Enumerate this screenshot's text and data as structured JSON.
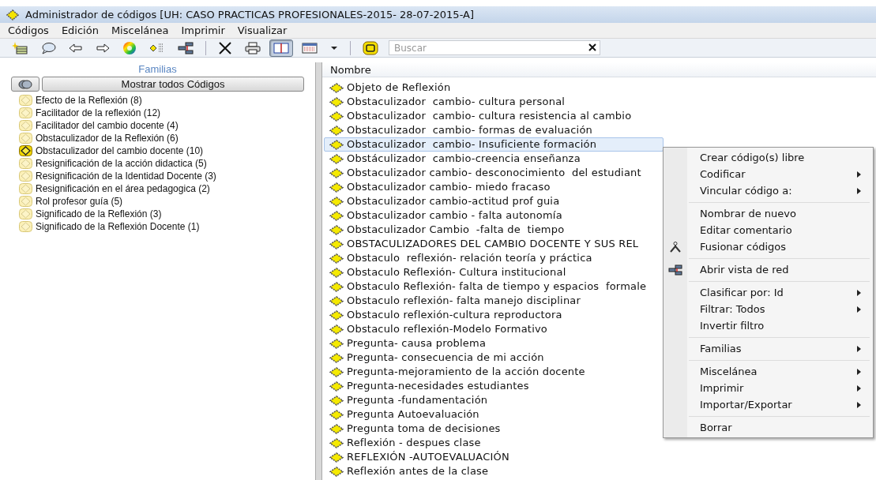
{
  "window": {
    "title": "Administrador de códigos [UH: CASO PRACTICAS PROFESIONALES-2015- 28-07-2015-A]"
  },
  "menu_bar": [
    "Códigos",
    "Edición",
    "Miscelánea",
    "Imprimir",
    "Visualizar"
  ],
  "toolbar": {
    "groups": [
      [
        {
          "kind": "new",
          "pressed": false
        },
        {
          "kind": "comment",
          "pressed": false
        },
        {
          "kind": "back",
          "pressed": false
        },
        {
          "kind": "forward",
          "pressed": false
        },
        {
          "kind": "color",
          "pressed": false
        },
        {
          "kind": "list",
          "pressed": false
        },
        {
          "kind": "network",
          "pressed": false
        }
      ],
      [
        {
          "kind": "delete",
          "pressed": false
        },
        {
          "kind": "print",
          "pressed": false
        },
        {
          "kind": "split",
          "pressed": true
        },
        {
          "kind": "grid",
          "pressed": false
        },
        {
          "kind": "dropdown",
          "pressed": false
        }
      ],
      [
        {
          "kind": "code",
          "pressed": false
        }
      ]
    ],
    "search": {
      "placeholder": "Buscar"
    }
  },
  "families": {
    "title": "Familias",
    "show_all_button": "Mostrar todos Códigos",
    "items": [
      {
        "label": "Efecto de la Reflexión (8)",
        "active": false
      },
      {
        "label": "Facilitador de la reflexión (12)",
        "active": false
      },
      {
        "label": "Facilitador del cambio docente (4)",
        "active": false
      },
      {
        "label": "Obstaculizador de la Reflexión (6)",
        "active": false
      },
      {
        "label": "Obstaculizador del cambio docente (10)",
        "active": true
      },
      {
        "label": "Resignificación de la acción didactica (5)",
        "active": false
      },
      {
        "label": "Resignificación de la Identidad Docente (3)",
        "active": false
      },
      {
        "label": "Resignificación en el área pedagogica (2)",
        "active": false
      },
      {
        "label": "Rol profesor guía (5)",
        "active": false
      },
      {
        "label": "Significado de la Reflexión (3)",
        "active": false
      },
      {
        "label": "Significado de la Reflexión Docente (1)",
        "active": false
      }
    ]
  },
  "codes": {
    "column": "Nombre",
    "rows": [
      {
        "name": "Objeto de Reflexión",
        "selected": false
      },
      {
        "name": "Obstaculizador  cambio- cultura personal",
        "selected": false
      },
      {
        "name": "Obstaculizador  cambio- cultura resistencia al cambio",
        "selected": false
      },
      {
        "name": "Obstaculizador  cambio- formas de evaluación",
        "selected": false
      },
      {
        "name": "Obstaculizador  cambio- Insuficiente formación",
        "selected": true
      },
      {
        "name": "Obstáculizador  cambio-creencia enseñanza",
        "selected": false
      },
      {
        "name": "Obstaculizador cambio- desconocimiento  del estudiant",
        "selected": false
      },
      {
        "name": "Obstaculizador cambio- miedo fracaso",
        "selected": false
      },
      {
        "name": "Obstaculizador cambio-actitud prof guia",
        "selected": false
      },
      {
        "name": "Obstaculizador cambio - falta autonomía",
        "selected": false
      },
      {
        "name": "Obstaculizador Cambio  -falta de  tiempo",
        "selected": false
      },
      {
        "name": "OBSTACULIZADORES DEL CAMBIO DOCENTE Y SUS REL",
        "selected": false
      },
      {
        "name": "Obstaculo  reflexión- relación teoría y práctica",
        "selected": false
      },
      {
        "name": "Obstaculo Reflexión- Cultura institucional",
        "selected": false
      },
      {
        "name": "Obstaculo Reflexión- falta de tiempo y espacios  formale",
        "selected": false
      },
      {
        "name": "Obstaculo reflexión- falta manejo disciplinar",
        "selected": false
      },
      {
        "name": "Obstaculo reflexión-cultura reproductora",
        "selected": false
      },
      {
        "name": "Obstaculo reflexión-Modelo Formativo",
        "selected": false
      },
      {
        "name": "Pregunta- causa problema",
        "selected": false
      },
      {
        "name": "Pregunta- consecuencia de mi acción",
        "selected": false
      },
      {
        "name": "Pregunta-mejoramiento de la acción docente",
        "selected": false
      },
      {
        "name": "Pregunta-necesidades estudiantes",
        "selected": false
      },
      {
        "name": "Pregunta -fundamentación",
        "selected": false
      },
      {
        "name": "Pregunta Autoevaluación",
        "selected": false
      },
      {
        "name": "Pregunta toma de decisiones",
        "selected": false
      },
      {
        "name": "Reflexión - despues clase",
        "selected": false
      },
      {
        "name": "REFLEXIÓN -AUTOEVALUACIÓN",
        "selected": false
      },
      {
        "name": "Reflexión antes de la clase",
        "selected": false
      }
    ]
  },
  "context_menu": {
    "groups": [
      [
        {
          "label": "Crear código(s) libre",
          "kind": "plain",
          "submenu": false
        },
        {
          "label": "Codificar",
          "kind": "plain",
          "submenu": true
        },
        {
          "label": "Vincular código a:",
          "kind": "plain",
          "submenu": true
        }
      ],
      [
        {
          "label": "Nombrar de nuevo",
          "kind": "plain",
          "submenu": false
        },
        {
          "label": "Editar comentario",
          "kind": "plain",
          "submenu": false
        },
        {
          "label": "Fusionar códigos",
          "kind": "merge",
          "submenu": false
        }
      ],
      [
        {
          "label": "Abrir vista de red",
          "kind": "network",
          "submenu": false
        }
      ],
      [
        {
          "label": "Clasificar por: Id",
          "kind": "plain",
          "submenu": true
        },
        {
          "label": "Filtrar: Todos",
          "kind": "plain",
          "submenu": true
        },
        {
          "label": "Invertir filtro",
          "kind": "plain",
          "submenu": false
        }
      ],
      [
        {
          "label": "Familias",
          "kind": "plain",
          "submenu": true
        }
      ],
      [
        {
          "label": "Miscelánea",
          "kind": "plain",
          "submenu": true
        },
        {
          "label": "Imprimir",
          "kind": "plain",
          "submenu": true
        },
        {
          "label": "Importar/Exportar",
          "kind": "plain",
          "submenu": true
        }
      ],
      [
        {
          "label": "Borrar",
          "kind": "plain",
          "submenu": false
        }
      ]
    ]
  }
}
